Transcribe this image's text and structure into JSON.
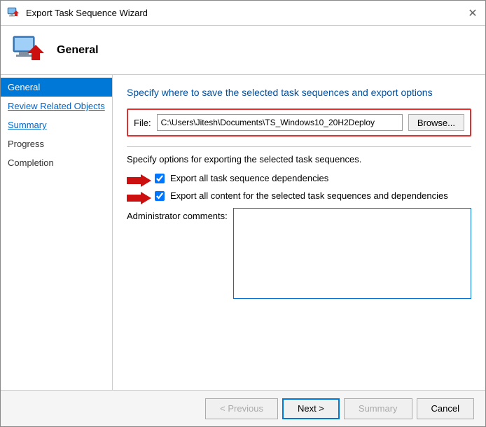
{
  "window": {
    "title": "Export Task Sequence Wizard",
    "close_label": "✕"
  },
  "header": {
    "title": "General"
  },
  "sidebar": {
    "items": [
      {
        "id": "general",
        "label": "General",
        "state": "active"
      },
      {
        "id": "review-related-objects",
        "label": "Review Related Objects",
        "state": "link"
      },
      {
        "id": "summary",
        "label": "Summary",
        "state": "link"
      },
      {
        "id": "progress",
        "label": "Progress",
        "state": "normal"
      },
      {
        "id": "completion",
        "label": "Completion",
        "state": "normal"
      }
    ]
  },
  "main": {
    "heading": "Specify where to save the selected task sequences and export options",
    "file_label": "File:",
    "file_value": "C:\\Users\\Jitesh\\Documents\\TS_Windows10_20H2Deploy",
    "browse_label": "Browse...",
    "divider": true,
    "options_text": "Specify options for exporting the selected task sequences.",
    "checkbox1_label": "Export all task sequence dependencies",
    "checkbox1_checked": true,
    "checkbox2_label": "Export all content for the selected task sequences and dependencies",
    "checkbox2_checked": true,
    "comments_label": "Administrator comments:",
    "comments_value": ""
  },
  "footer": {
    "previous_label": "< Previous",
    "next_label": "Next >",
    "summary_label": "Summary",
    "cancel_label": "Cancel"
  }
}
